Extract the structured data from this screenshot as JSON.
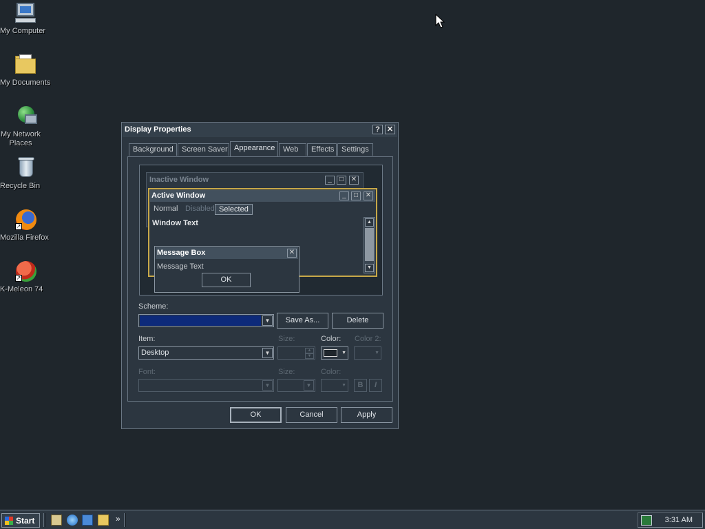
{
  "desktop": {
    "icons": [
      {
        "label": "My Computer",
        "icon": "my-computer-icon"
      },
      {
        "label": "My Documents",
        "icon": "my-documents-icon"
      },
      {
        "label": "My Network Places",
        "icon": "network-places-icon"
      },
      {
        "label": "Recycle Bin",
        "icon": "recycle-bin-icon"
      },
      {
        "label": "Mozilla Firefox",
        "icon": "firefox-icon"
      },
      {
        "label": "K-Meleon 74",
        "icon": "k-meleon-icon"
      }
    ],
    "background_color": "#1f262c"
  },
  "dialog": {
    "title": "Display Properties",
    "help_glyph": "?",
    "close_glyph": "✕",
    "tabs": [
      "Background",
      "Screen Saver",
      "Appearance",
      "Web",
      "Effects",
      "Settings"
    ],
    "active_tab": "Appearance",
    "preview": {
      "inactive_title": "Inactive Window",
      "active_title": "Active Window",
      "menu": [
        "Normal",
        "Disabled",
        "Selected"
      ],
      "window_text": "Window Text",
      "msgbox_title": "Message Box",
      "msgbox_text": "Message Text",
      "msgbox_ok": "OK"
    },
    "scheme": {
      "label": "Scheme:",
      "value": "",
      "save_as": "Save As...",
      "delete": "Delete"
    },
    "item": {
      "label": "Item:",
      "value": "Desktop",
      "size_label": "Size:",
      "color_label": "Color:",
      "color2_label": "Color 2:"
    },
    "font": {
      "label": "Font:",
      "size_label": "Size:",
      "color_label": "Color:",
      "bold": "B",
      "italic": "I"
    },
    "buttons": {
      "ok": "OK",
      "cancel": "Cancel",
      "apply": "Apply"
    }
  },
  "taskbar": {
    "start_label": "Start",
    "chevron": "»",
    "clock": "3:31 AM"
  },
  "colors": {
    "accent_active_border": "#c8a848",
    "scheme_fill": "#0d2a7a"
  }
}
